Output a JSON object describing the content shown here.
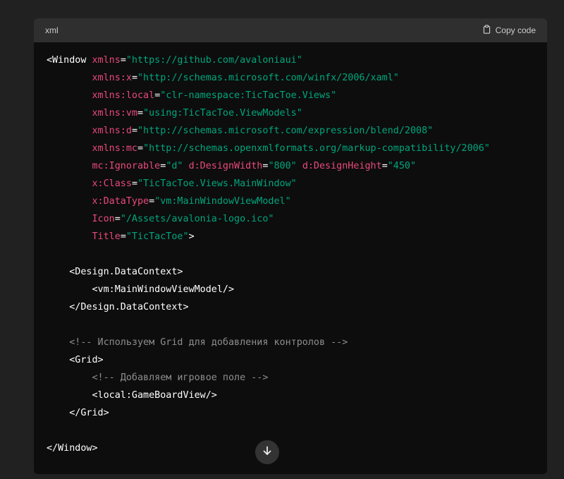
{
  "header": {
    "language": "xml",
    "copy_label": "Copy code"
  },
  "code_lines": [
    [
      {
        "t": "tag",
        "v": "<Window "
      },
      {
        "t": "attr",
        "v": "xmlns"
      },
      {
        "t": "punct",
        "v": "="
      },
      {
        "t": "str",
        "v": "\"https://github.com/avaloniaui\""
      }
    ],
    [
      {
        "t": "tag",
        "v": "        "
      },
      {
        "t": "attr",
        "v": "xmlns:x"
      },
      {
        "t": "punct",
        "v": "="
      },
      {
        "t": "str",
        "v": "\"http://schemas.microsoft.com/winfx/2006/xaml\""
      }
    ],
    [
      {
        "t": "tag",
        "v": "        "
      },
      {
        "t": "attr",
        "v": "xmlns:local"
      },
      {
        "t": "punct",
        "v": "="
      },
      {
        "t": "str",
        "v": "\"clr-namespace:TicTacToe.Views\""
      }
    ],
    [
      {
        "t": "tag",
        "v": "        "
      },
      {
        "t": "attr",
        "v": "xmlns:vm"
      },
      {
        "t": "punct",
        "v": "="
      },
      {
        "t": "str",
        "v": "\"using:TicTacToe.ViewModels\""
      }
    ],
    [
      {
        "t": "tag",
        "v": "        "
      },
      {
        "t": "attr",
        "v": "xmlns:d"
      },
      {
        "t": "punct",
        "v": "="
      },
      {
        "t": "str",
        "v": "\"http://schemas.microsoft.com/expression/blend/2008\""
      }
    ],
    [
      {
        "t": "tag",
        "v": "        "
      },
      {
        "t": "attr",
        "v": "xmlns:mc"
      },
      {
        "t": "punct",
        "v": "="
      },
      {
        "t": "str",
        "v": "\"http://schemas.openxmlformats.org/markup-compatibility/2006\""
      }
    ],
    [
      {
        "t": "tag",
        "v": "        "
      },
      {
        "t": "attr",
        "v": "mc:Ignorable"
      },
      {
        "t": "punct",
        "v": "="
      },
      {
        "t": "str",
        "v": "\"d\""
      },
      {
        "t": "tag",
        "v": " "
      },
      {
        "t": "attr",
        "v": "d:DesignWidth"
      },
      {
        "t": "punct",
        "v": "="
      },
      {
        "t": "str",
        "v": "\"800\""
      },
      {
        "t": "tag",
        "v": " "
      },
      {
        "t": "attr",
        "v": "d:DesignHeight"
      },
      {
        "t": "punct",
        "v": "="
      },
      {
        "t": "str",
        "v": "\"450\""
      }
    ],
    [
      {
        "t": "tag",
        "v": "        "
      },
      {
        "t": "attr",
        "v": "x:Class"
      },
      {
        "t": "punct",
        "v": "="
      },
      {
        "t": "str",
        "v": "\"TicTacToe.Views.MainWindow\""
      }
    ],
    [
      {
        "t": "tag",
        "v": "        "
      },
      {
        "t": "attr",
        "v": "x:DataType"
      },
      {
        "t": "punct",
        "v": "="
      },
      {
        "t": "str",
        "v": "\"vm:MainWindowViewModel\""
      }
    ],
    [
      {
        "t": "tag",
        "v": "        "
      },
      {
        "t": "attr",
        "v": "Icon"
      },
      {
        "t": "punct",
        "v": "="
      },
      {
        "t": "str",
        "v": "\"/Assets/avalonia-logo.ico\""
      }
    ],
    [
      {
        "t": "tag",
        "v": "        "
      },
      {
        "t": "attr",
        "v": "Title"
      },
      {
        "t": "punct",
        "v": "="
      },
      {
        "t": "str",
        "v": "\"TicTacToe\""
      },
      {
        "t": "tag",
        "v": ">"
      }
    ],
    [],
    [
      {
        "t": "tag",
        "v": "    <Design.DataContext>"
      }
    ],
    [
      {
        "t": "tag",
        "v": "        <vm:MainWindowViewModel/>"
      }
    ],
    [
      {
        "t": "tag",
        "v": "    </Design.DataContext>"
      }
    ],
    [],
    [
      {
        "t": "comment",
        "v": "    <!-- Используем Grid для добавления контролов -->"
      }
    ],
    [
      {
        "t": "tag",
        "v": "    <Grid>"
      }
    ],
    [
      {
        "t": "comment",
        "v": "        <!-- Добавляем игровое поле -->"
      }
    ],
    [
      {
        "t": "tag",
        "v": "        <local:GameBoardView/>"
      }
    ],
    [
      {
        "t": "tag",
        "v": "    </Grid>"
      }
    ],
    [],
    [
      {
        "t": "tag",
        "v": "</Window>"
      }
    ]
  ],
  "icons": {
    "copy": "clipboard-icon",
    "scroll": "arrow-down-icon"
  },
  "colors": {
    "page_bg": "#212121",
    "code_bg": "#0d0d0d",
    "header_bg": "#2f2f2f",
    "attr": "#e9497c",
    "string": "#00a67d",
    "comment": "#8e8e8e"
  }
}
